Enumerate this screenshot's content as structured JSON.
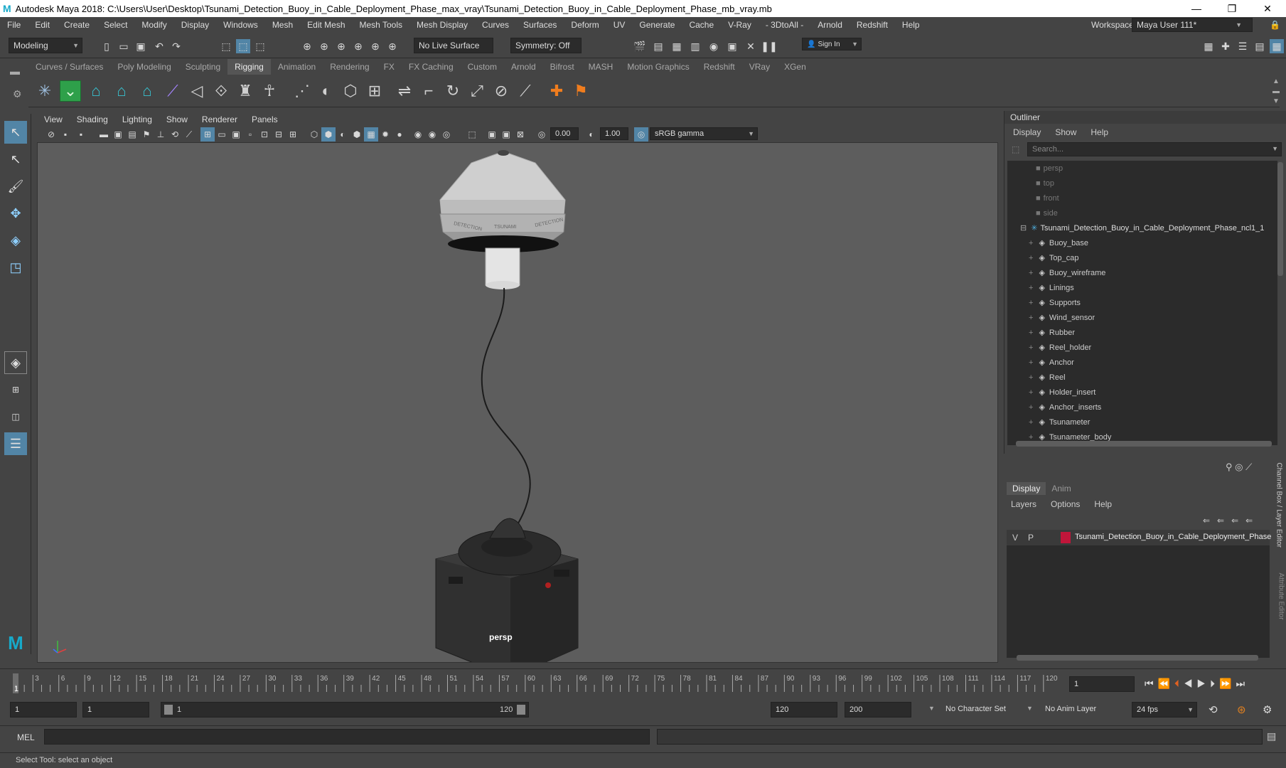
{
  "window": {
    "title": "Autodesk Maya 2018: C:\\Users\\User\\Desktop\\Tsunami_Detection_Buoy_in_Cable_Deployment_Phase_max_vray\\Tsunami_Detection_Buoy_in_Cable_Deployment_Phase_mb_vray.mb",
    "minimize": "—",
    "maximize": "❐",
    "close": "✕"
  },
  "menubar": [
    "File",
    "Edit",
    "Create",
    "Select",
    "Modify",
    "Display",
    "Windows",
    "Mesh",
    "Edit Mesh",
    "Mesh Tools",
    "Mesh Display",
    "Curves",
    "Surfaces",
    "Deform",
    "UV",
    "Generate",
    "Cache",
    "V-Ray",
    "- 3DtoAll -",
    "Arnold",
    "Redshift",
    "Help"
  ],
  "statusline": {
    "mode": "Modeling",
    "live_surface": "No Live Surface",
    "symmetry": "Symmetry: Off",
    "signin": "Sign In",
    "workspace_label": "Workspace :",
    "workspace": "Maya User 111*"
  },
  "shelf_tabs": [
    "Curves / Surfaces",
    "Poly Modeling",
    "Sculpting",
    "Rigging",
    "Animation",
    "Rendering",
    "FX",
    "FX Caching",
    "Custom",
    "Arnold",
    "Bifrost",
    "MASH",
    "Motion Graphics",
    "Redshift",
    "VRay",
    "XGen"
  ],
  "shelf_active": "Rigging",
  "viewport": {
    "menus": [
      "View",
      "Shading",
      "Lighting",
      "Show",
      "Renderer",
      "Panels"
    ],
    "exposure": "0.00",
    "gamma": "1.00",
    "colorspace": "sRGB gamma",
    "camera_label": "persp",
    "buoy_text_1": "DETECTION",
    "buoy_text_2": "TSUNAMI",
    "buoy_text_3": "DETECTION"
  },
  "outliner": {
    "title": "Outliner",
    "menus": [
      "Display",
      "Show",
      "Help"
    ],
    "search_placeholder": "Search...",
    "cameras": [
      "persp",
      "top",
      "front",
      "side"
    ],
    "root": "Tsunami_Detection_Buoy_in_Cable_Deployment_Phase_ncl1_1",
    "children": [
      "Buoy_base",
      "Top_cap",
      "Buoy_wireframe",
      "Linings",
      "Supports",
      "Wind_sensor",
      "Rubber",
      "Reel_holder",
      "Anchor",
      "Reel",
      "Holder_insert",
      "Anchor_inserts",
      "Tsunameter",
      "Tsunameter_body"
    ]
  },
  "layer_editor": {
    "tabs": [
      "Display",
      "Anim"
    ],
    "menus": [
      "Layers",
      "Options",
      "Help"
    ],
    "layer_v": "V",
    "layer_p": "P",
    "layer_name": "Tsunami_Detection_Buoy_in_Cable_Deployment_Phase",
    "layer_color": "#c0163a",
    "side_tab_1": "Channel Box / Layer Editor",
    "side_tab_2": "Attribute Editor"
  },
  "timeline": {
    "ticks": [
      "3",
      "6",
      "9",
      "12",
      "15",
      "18",
      "21",
      "24",
      "27",
      "30",
      "33",
      "36",
      "39",
      "42",
      "45",
      "48",
      "51",
      "54",
      "57",
      "60",
      "63",
      "66",
      "69",
      "72",
      "75",
      "78",
      "81",
      "84",
      "87",
      "90",
      "93",
      "96",
      "99",
      "102",
      "105",
      "108",
      "111",
      "114",
      "117",
      "120"
    ],
    "current_frame_marker": "1",
    "current_frame": "1"
  },
  "range": {
    "start": "1",
    "playback_start": "1",
    "slider_start": "1",
    "slider_end": "120",
    "playback_end": "120",
    "end": "200",
    "character_set": "No Character Set",
    "anim_layer": "No Anim Layer",
    "fps": "24 fps"
  },
  "command": {
    "label": "MEL"
  },
  "help": {
    "text": "Select Tool: select an object"
  }
}
